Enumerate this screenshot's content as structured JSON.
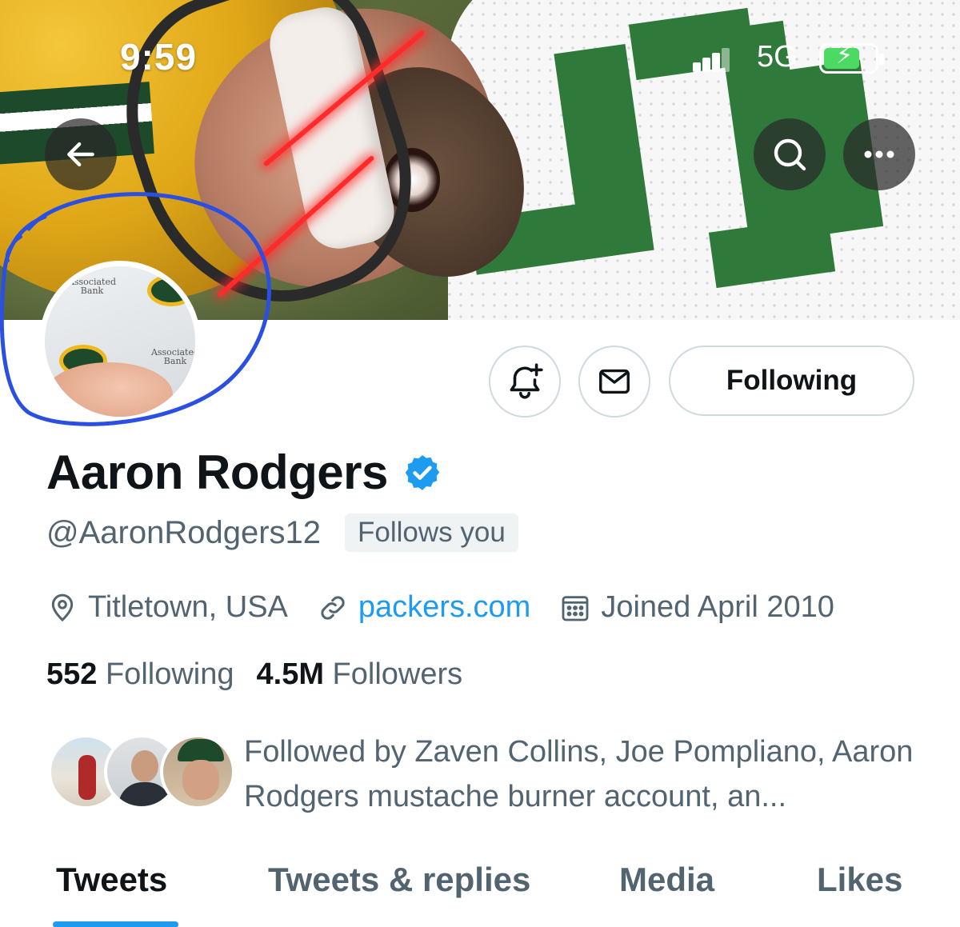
{
  "status_bar": {
    "time": "9:59",
    "network": "5G",
    "battery_state": "charging"
  },
  "header": {
    "back_icon": "arrow-left-icon",
    "search_icon": "search-icon",
    "more_icon": "more-horizontal-icon"
  },
  "avatar_image": {
    "logo_text": "Associated Bank"
  },
  "actions": {
    "notify_icon": "bell-plus-icon",
    "message_icon": "mail-icon",
    "follow_label": "Following"
  },
  "profile": {
    "name": "Aaron Rodgers",
    "verified": true,
    "handle": "@AaronRodgers12",
    "follows_you": "Follows you",
    "location": "Titletown, USA",
    "website": "packers.com",
    "joined": "Joined April 2010"
  },
  "stats": {
    "following_count": "552",
    "following_label": "Following",
    "followers_count": "4.5M",
    "followers_label": "Followers"
  },
  "followed_by": {
    "text": "Followed by Zaven Collins, Joe Pompliano, Aaron Rodgers mustache burner account, an..."
  },
  "tabs": [
    {
      "label": "Tweets",
      "active": true
    },
    {
      "label": "Tweets & replies",
      "active": false
    },
    {
      "label": "Media",
      "active": false
    },
    {
      "label": "Likes",
      "active": false
    }
  ],
  "colors": {
    "accent": "#1d9bf0",
    "annotation_circle": "#2b4fe0"
  }
}
